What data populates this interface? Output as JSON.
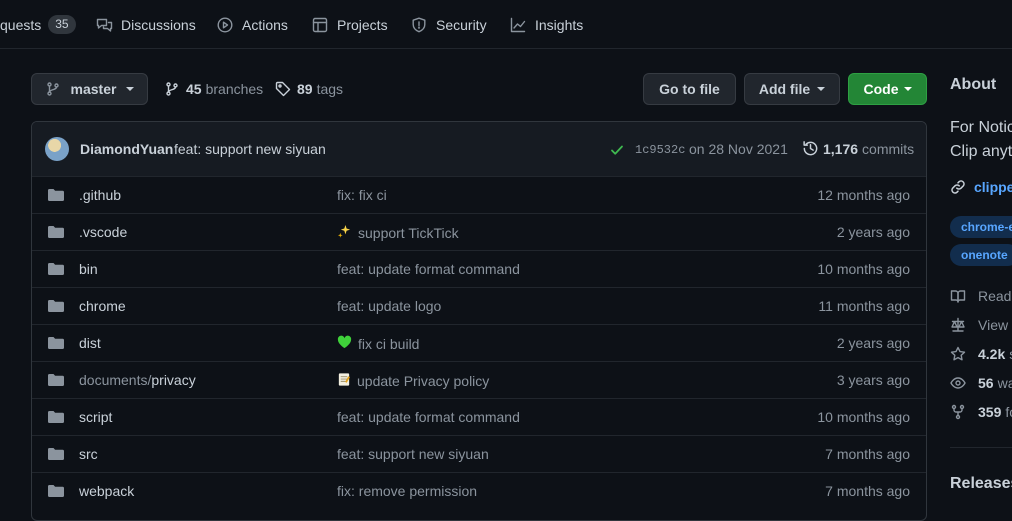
{
  "nav": {
    "pulls_label": "quests",
    "pulls_count": "35",
    "discussions": "Discussions",
    "actions": "Actions",
    "projects": "Projects",
    "security": "Security",
    "insights": "Insights"
  },
  "branchbar": {
    "branch": "master",
    "branches_count": "45",
    "branches_label": "branches",
    "tags_count": "89",
    "tags_label": "tags",
    "go_to_file": "Go to file",
    "add_file": "Add file",
    "code": "Code"
  },
  "commit": {
    "author": "DiamondYuan",
    "message": "feat: support new siyuan",
    "sha": "1c9532c",
    "date": "on 28 Nov 2021",
    "commits_count": "1,176",
    "commits_label": "commits"
  },
  "files": [
    {
      "name": ".github",
      "prefix": "",
      "message": "fix: fix ci",
      "emoji": "",
      "age": "12 months ago"
    },
    {
      "name": ".vscode",
      "prefix": "",
      "message": "support TickTick",
      "emoji": "sparkles",
      "age": "2 years ago"
    },
    {
      "name": "bin",
      "prefix": "",
      "message": "feat: update format command",
      "emoji": "",
      "age": "10 months ago"
    },
    {
      "name": "chrome",
      "prefix": "",
      "message": "feat: update logo",
      "emoji": "",
      "age": "11 months ago"
    },
    {
      "name": "dist",
      "prefix": "",
      "message": "fix ci build",
      "emoji": "green-heart",
      "age": "2 years ago"
    },
    {
      "name": "privacy",
      "prefix": "documents/",
      "message": "update Privacy policy",
      "emoji": "memo",
      "age": "3 years ago"
    },
    {
      "name": "script",
      "prefix": "",
      "message": "feat: update format command",
      "emoji": "",
      "age": "10 months ago"
    },
    {
      "name": "src",
      "prefix": "",
      "message": "feat: support new siyuan",
      "emoji": "",
      "age": "7 months ago"
    },
    {
      "name": "webpack",
      "prefix": "",
      "message": "fix: remove permission",
      "emoji": "",
      "age": "7 months ago"
    }
  ],
  "about": {
    "title": "About",
    "desc_line1": "For Notic",
    "desc_line2": "Clip anyt",
    "link": "clippe",
    "topics": [
      "chrome-e",
      "onenote"
    ],
    "items": [
      {
        "icon": "book-icon",
        "count": "",
        "label": "Readr"
      },
      {
        "icon": "law-icon",
        "count": "",
        "label": "View"
      },
      {
        "icon": "star-icon",
        "count": "4.2k",
        "label": "s"
      },
      {
        "icon": "eye-icon",
        "count": "56",
        "label": "wa"
      },
      {
        "icon": "fork-icon",
        "count": "359",
        "label": "fo"
      }
    ],
    "releases": "Releases"
  },
  "colors": {
    "background": "#0d1117",
    "accent_link": "#58a6ff",
    "code_button": "#238636",
    "success_check": "#3fb950"
  }
}
